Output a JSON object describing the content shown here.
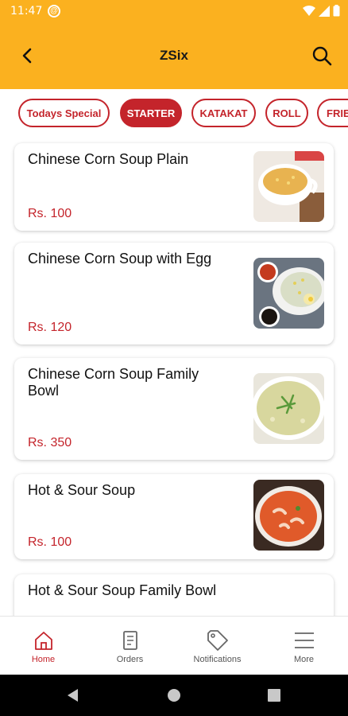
{
  "status_bar": {
    "time": "11:47"
  },
  "toolbar": {
    "title": "ZSix"
  },
  "categories": [
    {
      "label": "Todays Special",
      "active": false
    },
    {
      "label": "STARTER",
      "active": true
    },
    {
      "label": "KATAKAT",
      "active": false
    },
    {
      "label": "ROLL",
      "active": false
    },
    {
      "label": "FRIE",
      "active": false
    }
  ],
  "items": [
    {
      "name": "Chinese Corn Soup Plain",
      "price": "Rs. 100"
    },
    {
      "name": "Chinese Corn Soup with Egg",
      "price": "Rs. 120"
    },
    {
      "name": "Chinese Corn Soup Family Bowl",
      "price": "Rs. 350"
    },
    {
      "name": "Hot & Sour Soup",
      "price": "Rs. 100"
    },
    {
      "name": "Hot & Sour Soup Family Bowl",
      "price": ""
    }
  ],
  "bottom_nav": [
    {
      "label": "Home",
      "icon": "home-icon",
      "active": true
    },
    {
      "label": "Orders",
      "icon": "orders-icon",
      "active": false
    },
    {
      "label": "Notifications",
      "icon": "tag-icon",
      "active": false
    },
    {
      "label": "More",
      "icon": "menu-icon",
      "active": false
    }
  ],
  "colors": {
    "primary": "#fbb11f",
    "accent": "#c4242b"
  }
}
